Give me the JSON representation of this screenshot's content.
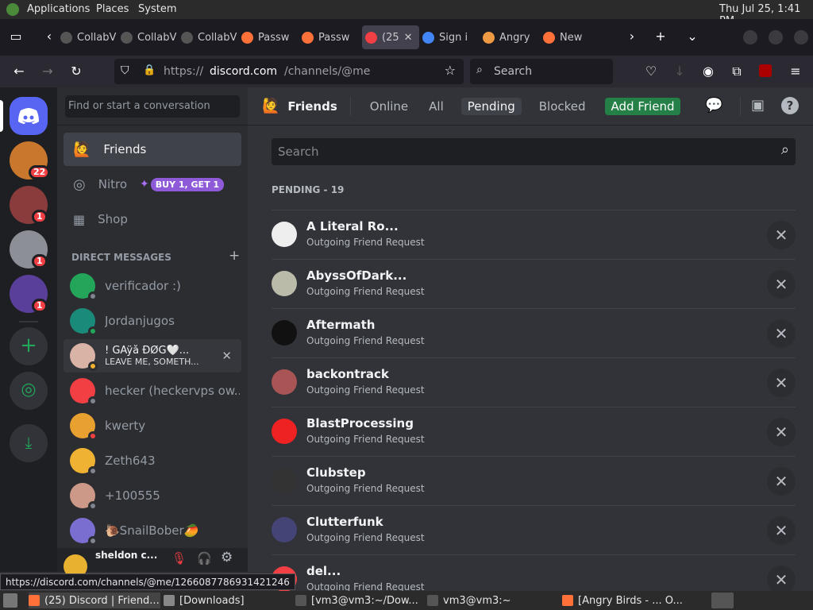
{
  "os_bar": {
    "menus": [
      "Applications",
      "Places",
      "System"
    ],
    "clock": "Thu Jul 25,  1:41 PM"
  },
  "browser": {
    "tabs": [
      {
        "label": "CollabV",
        "color": "#555"
      },
      {
        "label": "CollabV",
        "color": "#555"
      },
      {
        "label": "CollabV",
        "color": "#555"
      },
      {
        "label": "Passw",
        "color": "#ff7139"
      },
      {
        "label": "Passw",
        "color": "#ff7139"
      },
      {
        "label": "(25",
        "color": "#f23f43"
      },
      {
        "label": "Sign i",
        "color": "#4285f4"
      },
      {
        "label": "Angry",
        "color": "#e94"
      },
      {
        "label": "New",
        "color": "#ff7139"
      }
    ],
    "url_prefix": "https://",
    "url_host": "discord.com",
    "url_path": "/channels/@me",
    "search_placeholder": "Search"
  },
  "servers": {
    "badges": [
      "22",
      "1",
      "1",
      "1"
    ]
  },
  "sidebar": {
    "search_placeholder": "Find or start a conversation",
    "nav": {
      "friends": "Friends",
      "nitro": "Nitro",
      "nitro_promo": "BUY 1, GET 1",
      "shop": "Shop"
    },
    "dm_header": "DIRECT MESSAGES",
    "dms": [
      {
        "name": "verificador :)",
        "color": "#23a55a",
        "status": "#80848e"
      },
      {
        "name": "Jordanjugos",
        "color": "#1a8a7a",
        "status": "#23a55a"
      },
      {
        "name": "! GÄÿå ÐØG🤍...",
        "sub": "LEAVE ME, SOMETH...",
        "color": "#d9b3a6",
        "status": "#f0b232"
      },
      {
        "name": "hecker (heckervps ow...",
        "color": "#f23f43",
        "status": "#80848e"
      },
      {
        "name": "kwerty",
        "color": "#e8a030",
        "status": "#f23f43"
      },
      {
        "name": "Zeth643",
        "color": "#f0b232",
        "status": "#80848e"
      },
      {
        "name": "+100555",
        "color": "#c98",
        "status": "#80848e"
      },
      {
        "name": "🐌SnailBober🥭",
        "color": "#7a6fd0",
        "status": "#80848e"
      }
    ],
    "user": {
      "name": "sheldon c..."
    }
  },
  "main": {
    "tabs": {
      "friends": "Friends",
      "online": "Online",
      "all": "All",
      "pending": "Pending",
      "blocked": "Blocked",
      "add": "Add Friend"
    },
    "search_placeholder": "Search",
    "pending_header": "PENDING - 19",
    "requests": [
      {
        "name": "A Literal Ro...",
        "sub": "Outgoing Friend Request",
        "color": "#eee"
      },
      {
        "name": "AbyssOfDark...",
        "sub": "Outgoing Friend Request",
        "color": "#bba"
      },
      {
        "name": "Aftermath",
        "sub": "Outgoing Friend Request",
        "color": "#111"
      },
      {
        "name": "backontrack",
        "sub": "Outgoing Friend Request",
        "color": "#a55"
      },
      {
        "name": "BlastProcessing",
        "sub": "Outgoing Friend Request",
        "color": "#e22"
      },
      {
        "name": "Clubstep",
        "sub": "Outgoing Friend Request",
        "color": "#333"
      },
      {
        "name": "Clutterfunk",
        "sub": "Outgoing Friend Request",
        "color": "#447"
      },
      {
        "name": "del...",
        "sub": "Outgoing Friend Request",
        "color": "#f23f43"
      }
    ]
  },
  "status_url": "https://discord.com/channels/@me/1266087786931421246",
  "taskbar": [
    {
      "label": "(25) Discord | Friend...",
      "color": "#ff7139"
    },
    {
      "label": "[Downloads]",
      "color": "#888"
    },
    {
      "label": "[vm3@vm3:~/Dow...",
      "color": "#555"
    },
    {
      "label": "vm3@vm3:~",
      "color": "#555"
    },
    {
      "label": "[Angry Birds - ... O...",
      "color": "#ff7139"
    }
  ]
}
